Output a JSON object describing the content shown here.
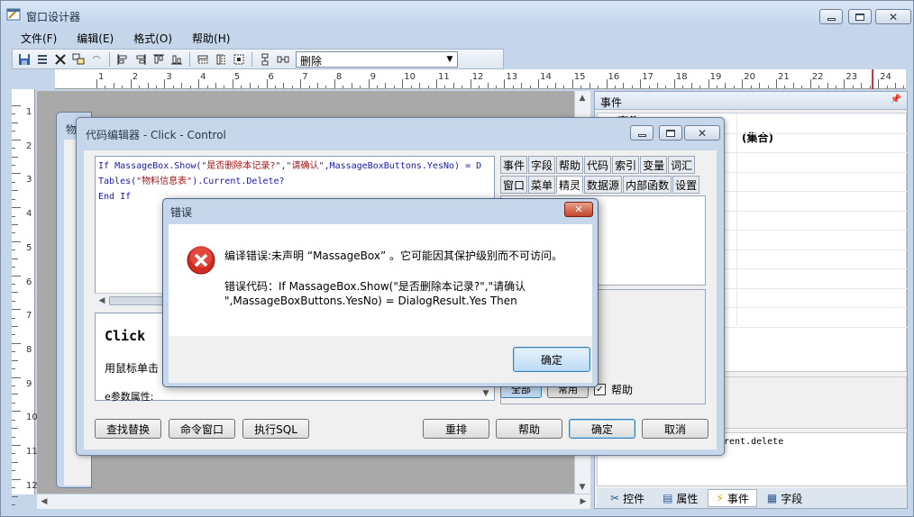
{
  "window": {
    "title": "窗口设计器",
    "min_glyph": "",
    "max_glyph": "",
    "close_glyph": "✕"
  },
  "menu": [
    {
      "label": "文件(F)"
    },
    {
      "label": "编辑(E)"
    },
    {
      "label": "格式(O)"
    },
    {
      "label": "帮助(H)"
    }
  ],
  "toolbar": {
    "combo_value": "删除",
    "icons": [
      "save-icon",
      "properties-icon",
      "delete-icon",
      "group-icon",
      "undo-icon",
      "align-left-icon",
      "align-right-icon",
      "align-top-icon",
      "align-bottom-icon",
      "same-width-icon",
      "same-height-icon",
      "same-size-icon",
      "tab-order-icon",
      "spacing-icon"
    ]
  },
  "ruler": {
    "h_numbers": [
      "1",
      "2",
      "3",
      "4",
      "5",
      "6",
      "7",
      "8",
      "9",
      "10",
      "11",
      "12",
      "13",
      "14",
      "15",
      "16",
      "17",
      "18",
      "19",
      "20",
      "21",
      "22",
      "23",
      "24"
    ],
    "v_numbers": [
      "1",
      "2",
      "3",
      "4",
      "5",
      "6",
      "7",
      "8",
      "9",
      "10",
      "11",
      "12"
    ]
  },
  "right_panel": {
    "title": "事件",
    "pin": "ᵖ",
    "grid_header_a": "事件",
    "grid_header_b": "(集合)",
    "code_preview": "rent.delete",
    "tabs": [
      {
        "label": "控件",
        "icon": "tools-icon"
      },
      {
        "label": "属性",
        "icon": "properties-icon"
      },
      {
        "label": "事件",
        "icon": "lightning-icon"
      },
      {
        "label": "字段",
        "icon": "fields-icon"
      }
    ]
  },
  "behind_dialog": {
    "title": "物"
  },
  "editor": {
    "title": "代码编辑器 - Click - Control",
    "code": {
      "line1_kw1": "If ",
      "line1_a": "MassageBox.Show(",
      "line1_s1": "\"是否删除本记录?\"",
      "line1_b": ",",
      "line1_s2": "\"请确认\"",
      "line1_c": ",MassageBoxButtons.YesNo) = D",
      "line2_a": "Tables(",
      "line2_s": "\"物料信息表\"",
      "line2_b": ").Current.Delete?",
      "line3_kw": "End If"
    },
    "help": {
      "title": "Click",
      "line1": "用鼠标单击",
      "line2": "e参数属性:"
    },
    "tabs_row1": [
      "事件",
      "字段",
      "帮助",
      "代码",
      "索引",
      "变量",
      "词汇"
    ],
    "tabs_row2": [
      "窗口",
      "菜单",
      "精灵",
      "数据源",
      "内部函数",
      "设置"
    ],
    "active_tab": "精灵",
    "side_btn1": "全部",
    "side_btn2": "常用",
    "help_check_label": "帮助",
    "help_checked": "✓",
    "buttons": {
      "find_replace": "查找替换",
      "command_window": "命令窗口",
      "execute_sql": "执行SQL",
      "rearrange": "重排",
      "help": "帮助",
      "ok": "确定",
      "cancel": "取消"
    }
  },
  "error_dialog": {
    "title": "错误",
    "close_glyph": "✕",
    "message": "编译错误:未声明 “MassageBox” 。它可能因其保护级别而不可访问。",
    "code_line1": "错误代码：If MassageBox.Show(\"是否删除本记录?\",\"请确认",
    "code_line2": "\",MassageBoxButtons.YesNo) = DialogResult.Yes Then",
    "ok_label": "确定"
  }
}
